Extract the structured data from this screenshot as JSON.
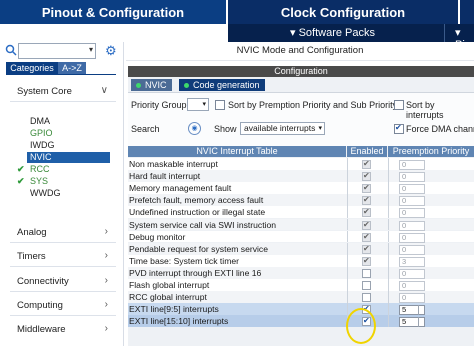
{
  "tabs": {
    "pinout": "Pinout & Configuration",
    "clock": "Clock Configuration",
    "software_packs": "▾ Software Packs",
    "pinout_short": "▾ Pin"
  },
  "sidebar": {
    "search_placeholder": "",
    "category_tabs": [
      "Categories",
      "A->Z"
    ],
    "groups": [
      {
        "label": "System Core",
        "expanded": true
      },
      {
        "label": "Analog"
      },
      {
        "label": "Timers"
      },
      {
        "label": "Connectivity"
      },
      {
        "label": "Computing"
      },
      {
        "label": "Middleware"
      }
    ],
    "system_core_items": [
      {
        "label": "DMA",
        "checked": false
      },
      {
        "label": "GPIO",
        "checked": false
      },
      {
        "label": "IWDG",
        "checked": false
      },
      {
        "label": "NVIC",
        "checked": false,
        "selected": true
      },
      {
        "label": "RCC",
        "checked": true
      },
      {
        "label": "SYS",
        "checked": true
      },
      {
        "label": "WWDG",
        "checked": false
      }
    ]
  },
  "main": {
    "mode_title": "NVIC Mode and Configuration",
    "config_title": "Configuration",
    "subtabs": [
      "NVIC",
      "Code generation"
    ],
    "priority_group_label": "Priority Group",
    "priority_group_value": "",
    "sort_premption_label": "Sort by Premption Priority and Sub Priority",
    "sort_interrupts_label": "Sort by interrupts",
    "search_label": "Search",
    "show_label": "Show",
    "show_value": "available interrupts",
    "force_dma_label": "Force DMA chann",
    "force_dma_checked": true
  },
  "table": {
    "headers": [
      "NVIC Interrupt Table",
      "Enabled",
      "Preemption Priority"
    ],
    "rows": [
      {
        "name": "Non maskable interrupt",
        "enabled": true,
        "locked": true,
        "priority": "0"
      },
      {
        "name": "Hard fault interrupt",
        "enabled": true,
        "locked": true,
        "priority": "0"
      },
      {
        "name": "Memory management fault",
        "enabled": true,
        "locked": true,
        "priority": "0"
      },
      {
        "name": "Prefetch fault, memory access fault",
        "enabled": true,
        "locked": true,
        "priority": "0"
      },
      {
        "name": "Undefined instruction or illegal state",
        "enabled": true,
        "locked": true,
        "priority": "0"
      },
      {
        "name": "System service call via SWI instruction",
        "enabled": true,
        "locked": true,
        "priority": "0"
      },
      {
        "name": "Debug monitor",
        "enabled": true,
        "locked": true,
        "priority": "0"
      },
      {
        "name": "Pendable request for system service",
        "enabled": true,
        "locked": true,
        "priority": "0"
      },
      {
        "name": "Time base: System tick timer",
        "enabled": true,
        "locked": true,
        "priority": "3"
      },
      {
        "name": "PVD interrupt through EXTI line 16",
        "enabled": false,
        "locked": false,
        "priority": "0"
      },
      {
        "name": "Flash global interrupt",
        "enabled": false,
        "locked": false,
        "priority": "0"
      },
      {
        "name": "RCC global interrupt",
        "enabled": false,
        "locked": false,
        "priority": "0"
      },
      {
        "name": "EXTI line[9:5] interrupts",
        "enabled": true,
        "locked": false,
        "priority": "5"
      },
      {
        "name": "EXTI line[15:10] interrupts",
        "enabled": true,
        "locked": false,
        "priority": "5"
      }
    ]
  }
}
